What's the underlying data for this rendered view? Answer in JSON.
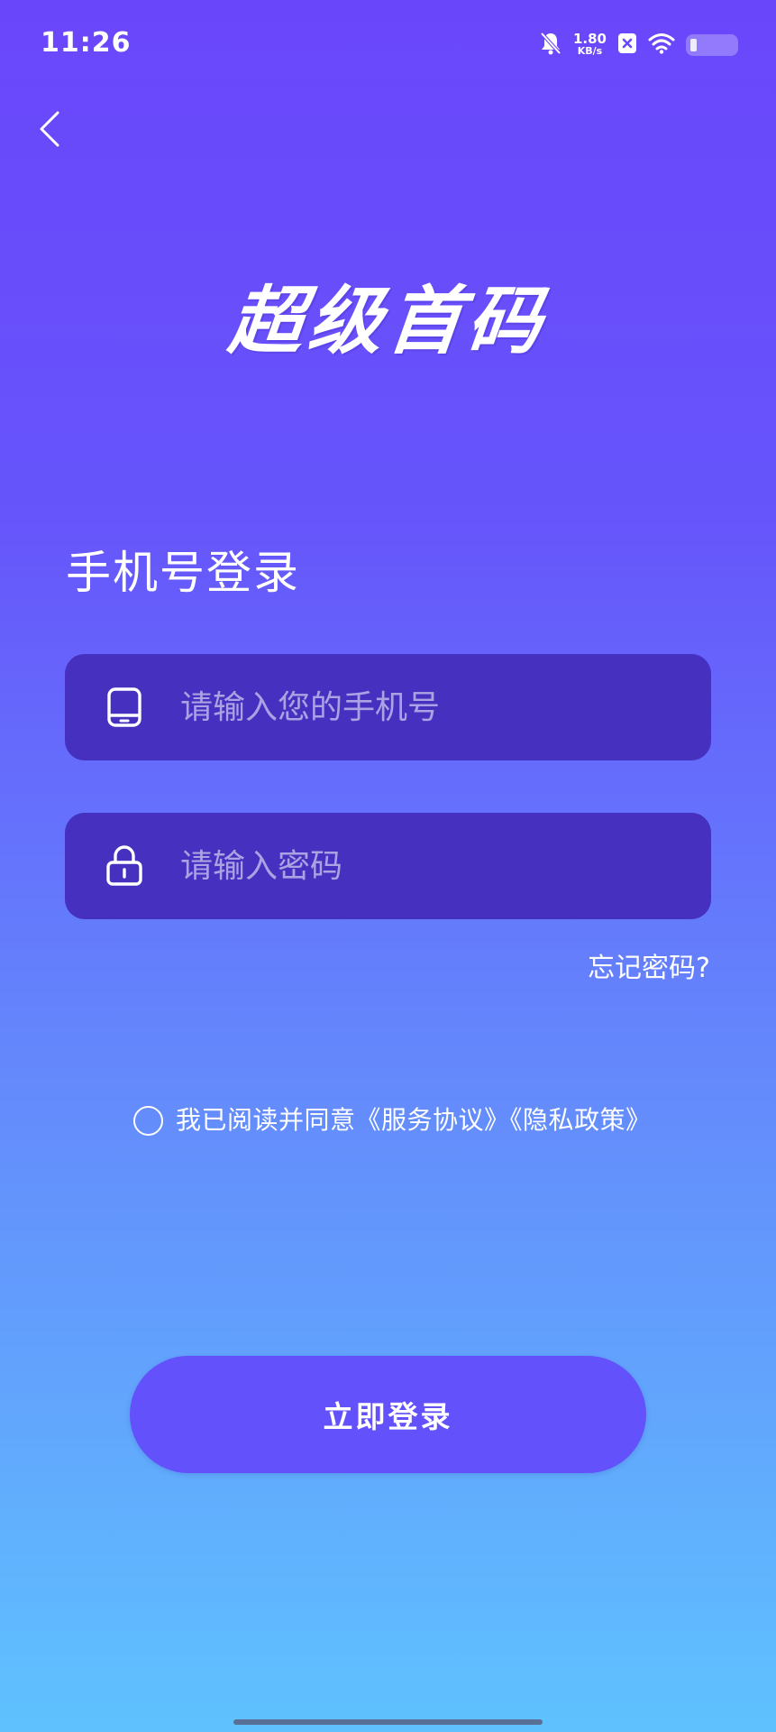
{
  "status_bar": {
    "time": "11:26",
    "net_speed_value": "1.80",
    "net_speed_unit": "KB/s",
    "icons": [
      "bell-muted-icon",
      "close-box-icon",
      "wifi-icon",
      "battery-icon"
    ]
  },
  "nav": {
    "back_icon": "chevron-left-icon"
  },
  "brand": {
    "logo_text": "超级首码"
  },
  "form": {
    "title": "手机号登录",
    "phone_placeholder": "请输入您的手机号",
    "password_placeholder": "请输入密码",
    "phone_icon": "phone-icon",
    "lock_icon": "lock-icon",
    "forgot_password": "忘记密码?"
  },
  "agreement": {
    "prefix": "我已阅读并同意",
    "service_terms": "《服务协议》",
    "privacy_policy": "《隐私政策》",
    "checked": false
  },
  "actions": {
    "login_label": "立即登录"
  },
  "colors": {
    "gradient_top": "#6a46fb",
    "gradient_bottom": "#5fc2fe",
    "field_bg": "#4530c0",
    "button_bg": "#6352fb"
  }
}
